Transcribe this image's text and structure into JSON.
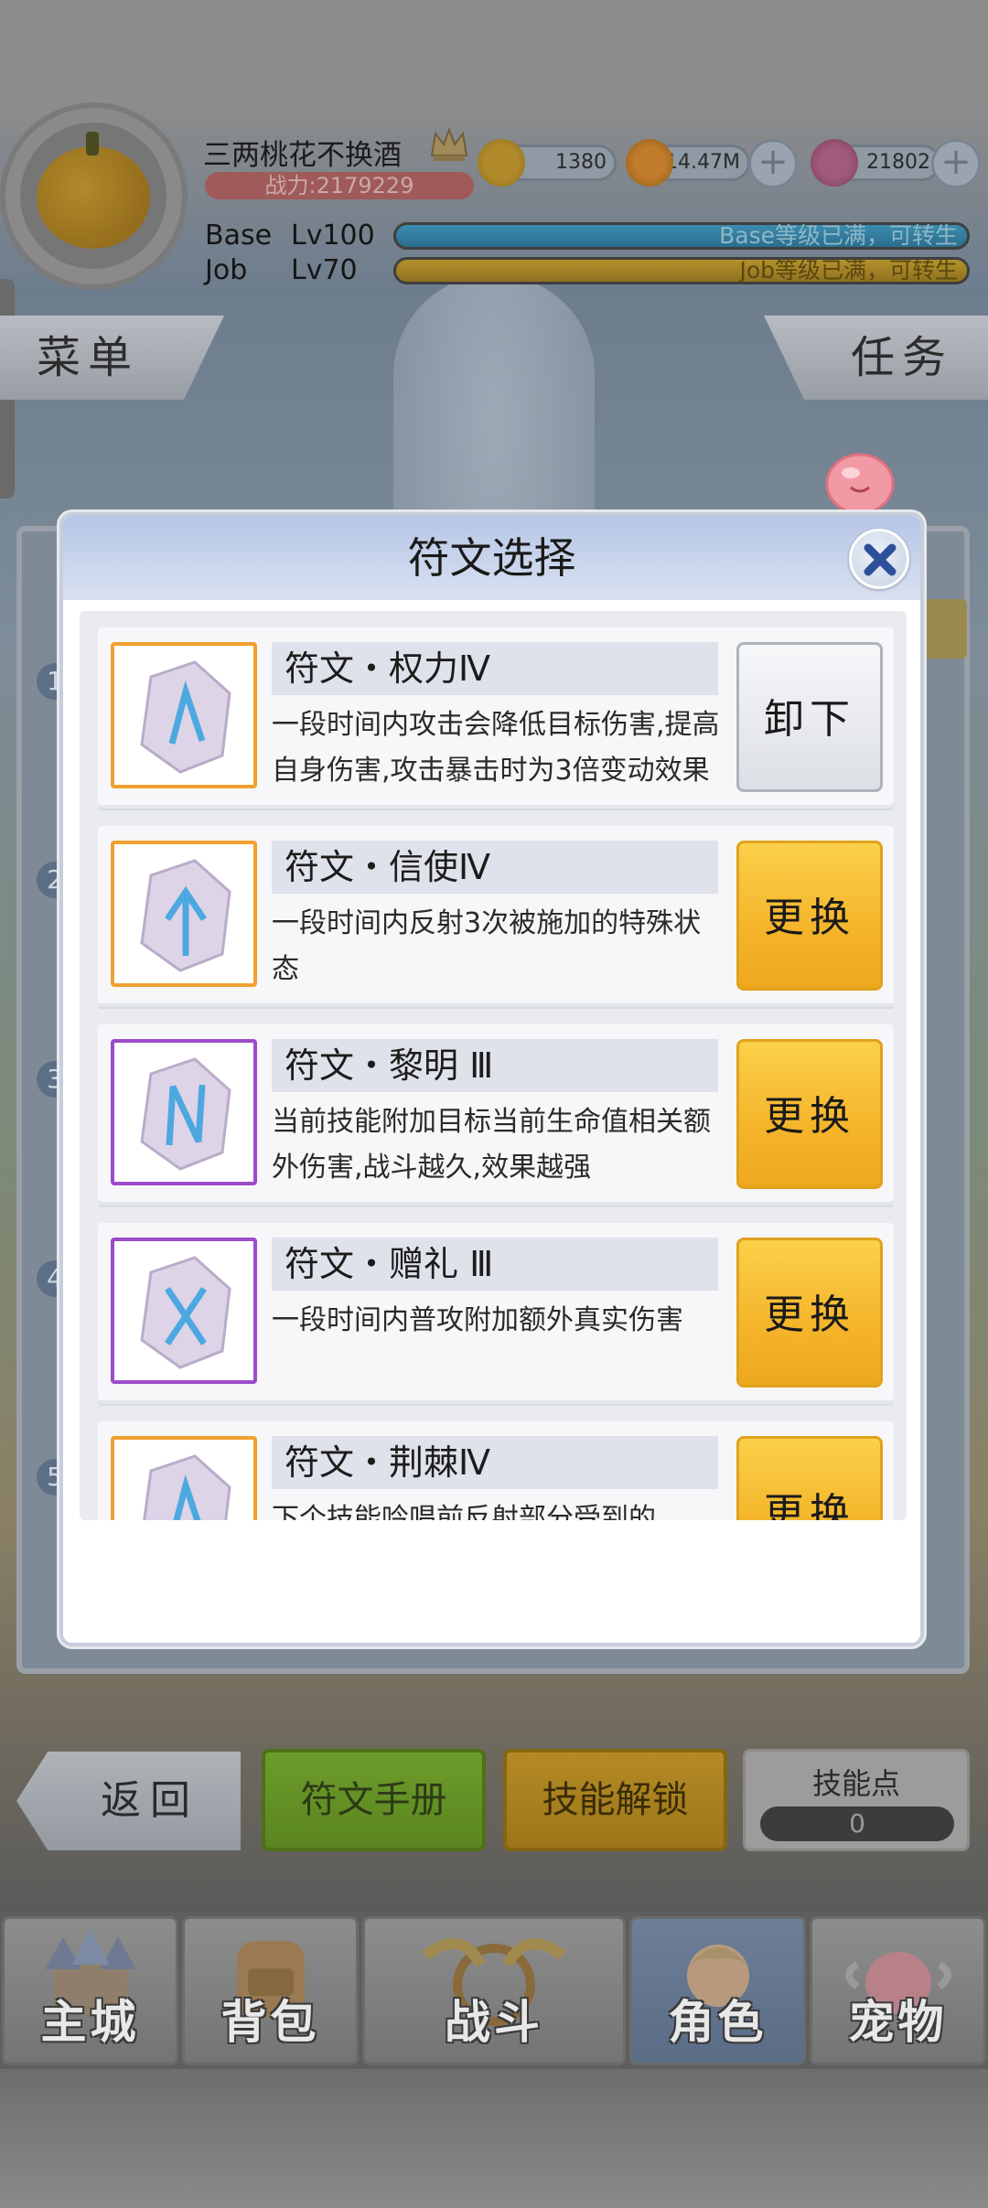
{
  "header": {
    "player_name": "三两桃花不换酒",
    "power": "战力:2179229",
    "currencies": [
      {
        "icon": "zeny-coin-icon",
        "value": "1380"
      },
      {
        "icon": "gold-pot-icon",
        "value": "14.47M"
      },
      {
        "icon": "crystal-gem-icon",
        "value": "21802"
      }
    ],
    "base": {
      "label": "Base",
      "level": "Lv100",
      "bar_text": "Base等级已满，可转生",
      "progress": 1.0
    },
    "job": {
      "label": "Job",
      "level": "Lv70",
      "bar_text": "Job等级已满，可转生",
      "progress": 1.0
    }
  },
  "side": {
    "menu_label": "菜单",
    "task_label": "任务"
  },
  "under_panel": {
    "row_numbers": [
      "1",
      "2",
      "3",
      "4",
      "5"
    ]
  },
  "modal": {
    "title": "符文选择",
    "runes": [
      {
        "name": "符文・权力Ⅳ",
        "desc": "一段时间内攻击会降低目标伤害,提高自身伤害,攻击暴击时为3倍变动效果",
        "button": "卸下",
        "rarity": "orange"
      },
      {
        "name": "符文・信使Ⅳ",
        "desc": "一段时间内反射3次被施加的特殊状态",
        "button": "更换",
        "rarity": "orange"
      },
      {
        "name": "符文・黎明 Ⅲ",
        "desc": "当前技能附加目标当前生命值相关额外伤害,战斗越久,效果越强",
        "button": "更换",
        "rarity": "purple"
      },
      {
        "name": "符文・赠礼 Ⅲ",
        "desc": "一段时间内普攻附加额外真实伤害",
        "button": "更换",
        "rarity": "purple"
      },
      {
        "name": "符文・荆棘Ⅳ",
        "desc": "下个技能吟唱前反射部分受到的",
        "button": "更换",
        "rarity": "orange"
      }
    ]
  },
  "bottom": {
    "back_label": "返回",
    "manual_label": "符文手册",
    "unlock_label": "技能解锁",
    "skill_points_label": "技能点",
    "skill_points_value": "0"
  },
  "nav": [
    {
      "label": "主城",
      "icon": "castle-icon"
    },
    {
      "label": "背包",
      "icon": "backpack-icon"
    },
    {
      "label": "战斗",
      "icon": "battle-wheel-icon"
    },
    {
      "label": "角色",
      "icon": "character-icon",
      "active": true
    },
    {
      "label": "宠物",
      "icon": "pet-poring-icon"
    }
  ],
  "colors": {
    "gold_button": "#f4b42a",
    "orange_rarity": "#f0a030",
    "purple_rarity": "#9b4cc9",
    "modal_header": "#c4d0ea"
  }
}
